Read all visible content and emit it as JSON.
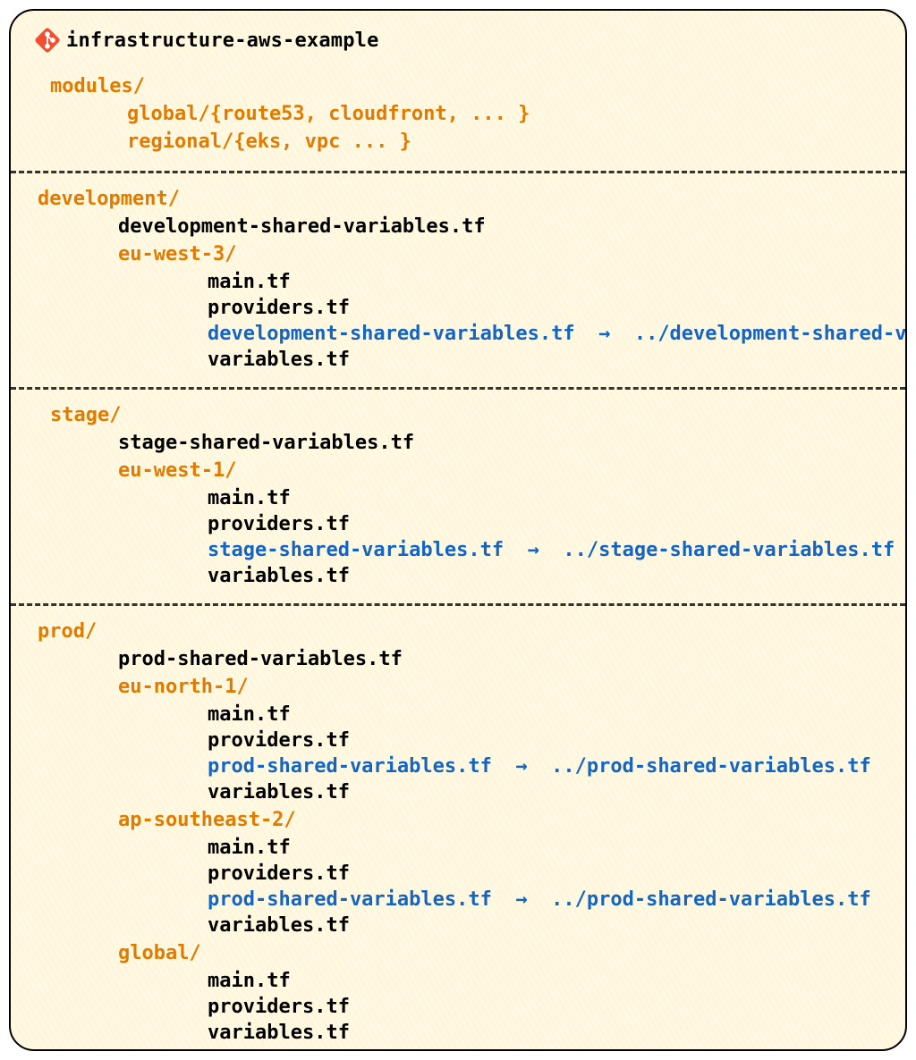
{
  "icon": "git-icon",
  "repo": "infrastructure-aws-example",
  "colors": {
    "dir": "#e07b00",
    "file": "#000000",
    "symlink": "#1565c0",
    "bg": "#fff9e3"
  },
  "modules": {
    "name": "modules/",
    "globalLine": "global/{route53, cloudfront, ... }",
    "regionalLine": "regional/{eks,  vpc ... }"
  },
  "environments": [
    {
      "name": "development/",
      "sharedVars": "development-shared-variables.tf",
      "regions": [
        {
          "name": "eu-west-3/",
          "files": [
            {
              "type": "file",
              "text": "main.tf"
            },
            {
              "type": "file",
              "text": "providers.tf"
            },
            {
              "type": "symlink",
              "text": "development-shared-variables.tf  →  ../development-shared-variables.tf"
            },
            {
              "type": "file",
              "text": "variables.tf"
            }
          ]
        }
      ]
    },
    {
      "name": "stage/",
      "sharedVars": "stage-shared-variables.tf",
      "regions": [
        {
          "name": "eu-west-1/",
          "files": [
            {
              "type": "file",
              "text": "main.tf"
            },
            {
              "type": "file",
              "text": "providers.tf"
            },
            {
              "type": "symlink",
              "text": "stage-shared-variables.tf  →  ../stage-shared-variables.tf"
            },
            {
              "type": "file",
              "text": "variables.tf"
            }
          ]
        }
      ]
    },
    {
      "name": "prod/",
      "sharedVars": "prod-shared-variables.tf",
      "regions": [
        {
          "name": "eu-north-1/",
          "files": [
            {
              "type": "file",
              "text": "main.tf"
            },
            {
              "type": "file",
              "text": "providers.tf"
            },
            {
              "type": "symlink",
              "text": "prod-shared-variables.tf  →  ../prod-shared-variables.tf"
            },
            {
              "type": "file",
              "text": "variables.tf"
            }
          ]
        },
        {
          "name": "ap-southeast-2/",
          "files": [
            {
              "type": "file",
              "text": "main.tf"
            },
            {
              "type": "file",
              "text": "providers.tf"
            },
            {
              "type": "symlink",
              "text": "prod-shared-variables.tf  →  ../prod-shared-variables.tf"
            },
            {
              "type": "file",
              "text": "variables.tf"
            }
          ]
        },
        {
          "name": "global/",
          "files": [
            {
              "type": "file",
              "text": "main.tf"
            },
            {
              "type": "file",
              "text": "providers.tf"
            },
            {
              "type": "file",
              "text": "variables.tf"
            }
          ]
        }
      ]
    }
  ]
}
